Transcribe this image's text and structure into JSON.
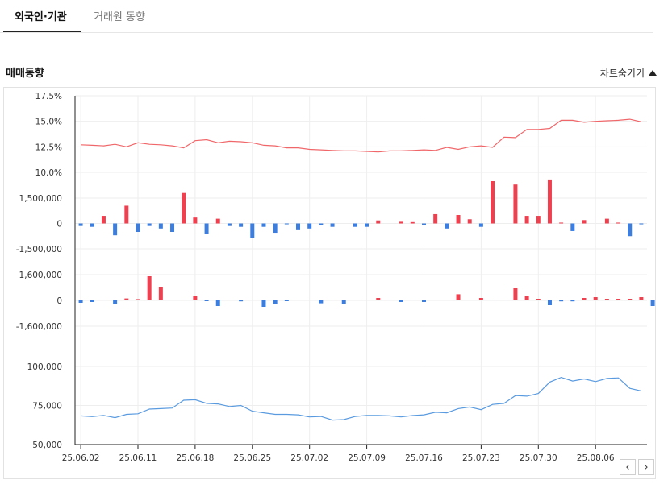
{
  "tabs": [
    {
      "label": "외국인·기관",
      "active": true
    },
    {
      "label": "거래원 동향",
      "active": false
    }
  ],
  "section_title": "매매동향",
  "hide_chart_label": "차트숨기기",
  "nav": {
    "prev": "‹",
    "next": "›"
  },
  "colors": {
    "up": "#ef4050",
    "down": "#3b7ee0",
    "line_red": "#f0676a",
    "line_blue": "#5a9be0",
    "grid": "#eeeeee"
  },
  "chart_data": {
    "type": "line",
    "x_labels": [
      "25.06.02",
      "25.06.11",
      "25.06.18",
      "25.06.25",
      "25.07.02",
      "25.07.09",
      "25.07.16",
      "25.07.23",
      "25.07.30",
      "25.08.06"
    ],
    "x_label_index": [
      0,
      5,
      10,
      15,
      20,
      25,
      30,
      35,
      40,
      45
    ],
    "panels": [
      {
        "name": "foreign_ratio",
        "type": "line",
        "ticks": [
          "17.5%",
          "15.0%",
          "12.5%",
          "10.0%"
        ],
        "ylim": [
          10,
          17.5
        ],
        "values": [
          12.7,
          12.65,
          12.6,
          12.75,
          12.5,
          12.9,
          12.75,
          12.7,
          12.6,
          12.4,
          13.1,
          13.2,
          12.9,
          13.05,
          13.0,
          12.9,
          12.65,
          12.6,
          12.4,
          12.4,
          12.25,
          12.2,
          12.15,
          12.1,
          12.1,
          12.05,
          12.0,
          12.1,
          12.1,
          12.15,
          12.2,
          12.15,
          12.45,
          12.25,
          12.5,
          12.6,
          12.45,
          13.45,
          13.4,
          14.2,
          14.2,
          14.3,
          15.1,
          15.1,
          14.9,
          15.0,
          15.05,
          15.1,
          15.2,
          14.95
        ]
      },
      {
        "name": "foreign_net",
        "type": "bar",
        "ticks": [
          "1,500,000",
          "0",
          "-1,500,000"
        ],
        "ylim": [
          -1500000,
          1500000
        ],
        "values": [
          -150000,
          -200000,
          450000,
          -700000,
          1050000,
          -500000,
          -150000,
          -300000,
          -500000,
          1800000,
          350000,
          -600000,
          280000,
          -150000,
          -200000,
          -850000,
          -200000,
          -550000,
          -50000,
          -350000,
          -300000,
          -100000,
          -200000,
          0,
          -200000,
          -200000,
          180000,
          0,
          100000,
          80000,
          -100000,
          550000,
          -300000,
          500000,
          250000,
          -200000,
          2500000,
          0,
          2300000,
          450000,
          450000,
          2600000,
          50000,
          -450000,
          200000,
          0,
          280000,
          50000,
          -750000,
          -50000
        ]
      },
      {
        "name": "institution_net",
        "type": "bar",
        "ticks": [
          "1,600,000",
          "0",
          "-1,600,000"
        ],
        "ylim": [
          -1600000,
          1600000
        ],
        "values": [
          -150000,
          -100000,
          0,
          -200000,
          120000,
          80000,
          1500000,
          850000,
          0,
          0,
          280000,
          -40000,
          -350000,
          0,
          -60000,
          50000,
          -400000,
          -250000,
          -50000,
          0,
          0,
          -180000,
          0,
          -200000,
          0,
          0,
          150000,
          0,
          -100000,
          0,
          -100000,
          0,
          0,
          380000,
          0,
          150000,
          50000,
          0,
          750000,
          300000,
          100000,
          -300000,
          -60000,
          -60000,
          150000,
          200000,
          100000,
          100000,
          100000,
          200000,
          -350000,
          100000
        ]
      },
      {
        "name": "price",
        "type": "line",
        "ticks": [
          "100,000",
          "75,000",
          "50,000"
        ],
        "ylim": [
          50000,
          125000
        ],
        "values": [
          77500,
          76800,
          78000,
          75800,
          79000,
          79500,
          84000,
          84500,
          85000,
          92500,
          93000,
          89500,
          89000,
          86500,
          87500,
          82000,
          80500,
          79000,
          79000,
          78500,
          76500,
          77000,
          73500,
          74000,
          77000,
          78000,
          78000,
          77500,
          76500,
          77800,
          78500,
          81000,
          80500,
          84500,
          86000,
          83500,
          88500,
          89500,
          97000,
          96500,
          99000,
          110000,
          114500,
          111000,
          113000,
          110500,
          113500,
          114000,
          104000,
          101500
        ]
      }
    ]
  }
}
